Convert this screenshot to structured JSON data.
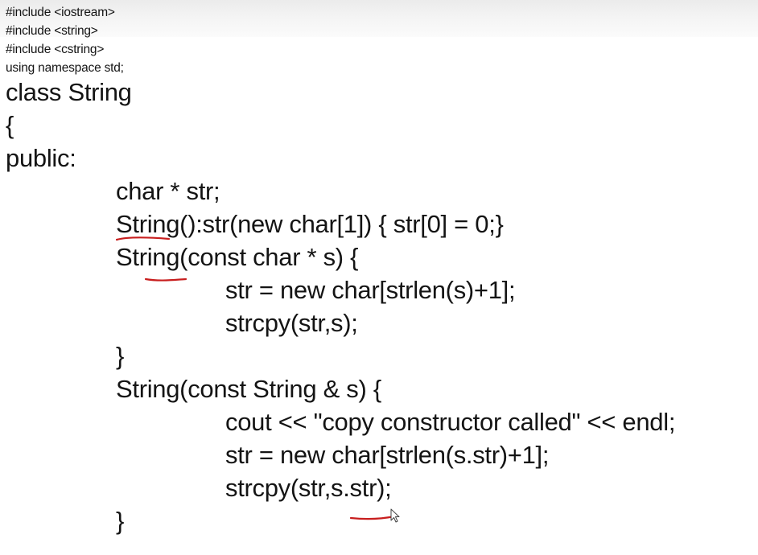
{
  "code": {
    "includes": [
      "#include <iostream>",
      "#include <string>",
      "#include <cstring>",
      "using namespace std;"
    ],
    "lines": [
      "class String",
      "{",
      "public:",
      "char * str;",
      "String():str(new char[1]) { str[0] = 0;}",
      "String(const char * s) {",
      "str = new char[strlen(s)+1];",
      "strcpy(str,s);",
      "}",
      "String(const String & s) {",
      "cout << \"copy constructor called\" << endl;",
      "str = new char[strlen(s.str)+1];",
      "strcpy(str,s.str);",
      "}"
    ]
  },
  "annotation": {
    "ink_color": "#c81e1e",
    "cursor_icon": "mouse-pointer-icon"
  }
}
